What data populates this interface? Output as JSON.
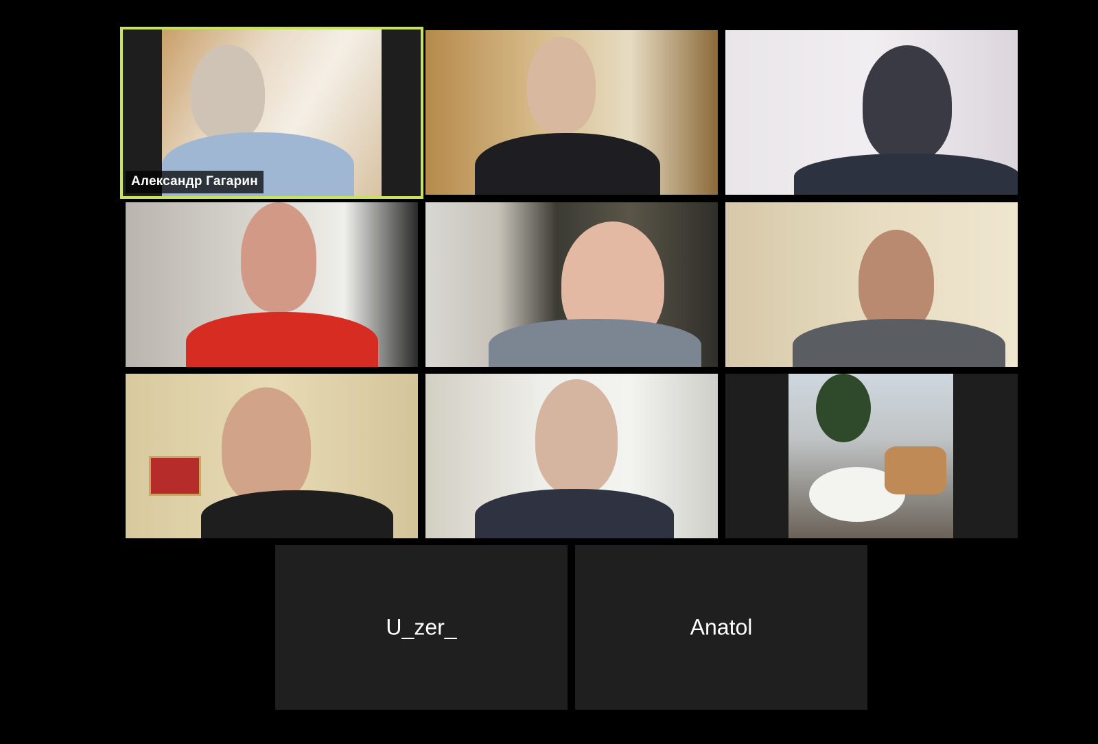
{
  "meeting": {
    "participants": [
      {
        "name": "Александр Гагарин",
        "video": true,
        "active_speaker": true,
        "name_shown": true
      },
      {
        "name": "",
        "video": true,
        "active_speaker": false,
        "name_shown": false
      },
      {
        "name": "",
        "video": true,
        "active_speaker": false,
        "name_shown": false
      },
      {
        "name": "",
        "video": true,
        "active_speaker": false,
        "name_shown": false
      },
      {
        "name": "",
        "video": true,
        "active_speaker": false,
        "name_shown": false
      },
      {
        "name": "",
        "video": true,
        "active_speaker": false,
        "name_shown": false
      },
      {
        "name": "",
        "video": true,
        "active_speaker": false,
        "name_shown": false
      },
      {
        "name": "",
        "video": true,
        "active_speaker": false,
        "name_shown": false
      },
      {
        "name": "",
        "video": true,
        "active_speaker": false,
        "name_shown": false
      },
      {
        "name": "U_zer_",
        "video": false,
        "active_speaker": false,
        "name_shown": true
      },
      {
        "name": "Anatol",
        "video": false,
        "active_speaker": false,
        "name_shown": true
      }
    ]
  },
  "colors": {
    "background": "#000000",
    "tile_background": "#1f1f1f",
    "active_speaker_outline": "#c8e35a",
    "name_text": "#ffffff"
  }
}
